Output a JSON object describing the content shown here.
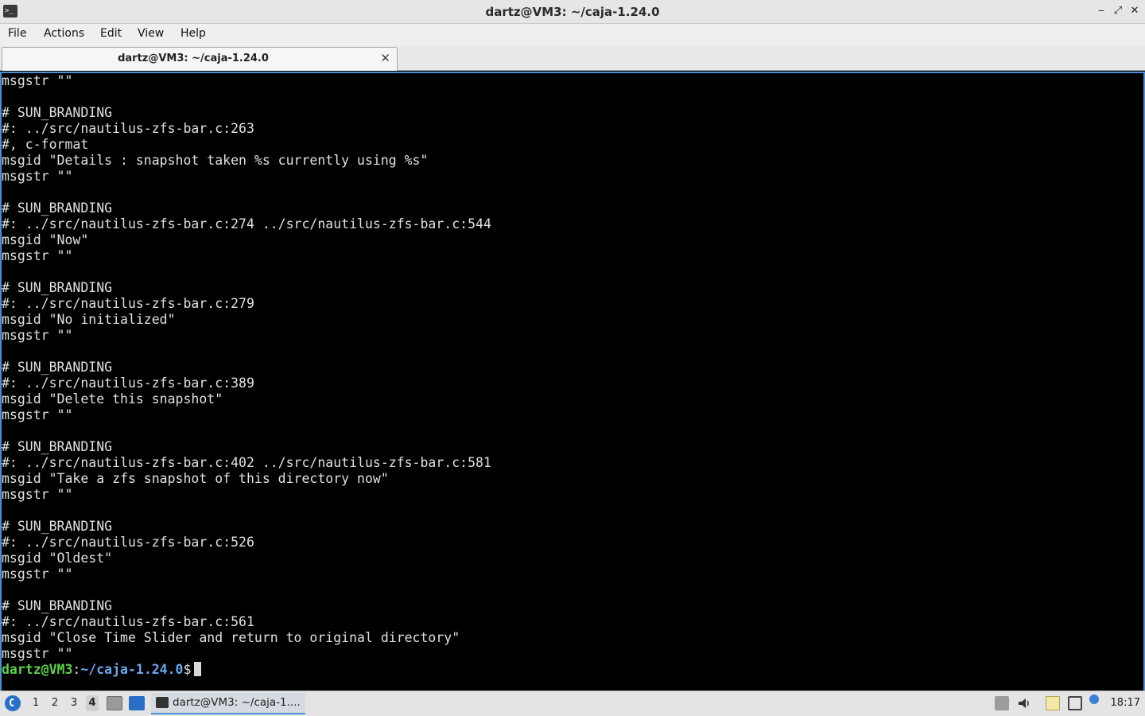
{
  "window": {
    "title": "dartz@VM3: ~/caja-1.24.0",
    "controls": {
      "minimize": "‒",
      "maximize": "⤢",
      "close": "✕"
    }
  },
  "menubar": {
    "items": [
      "File",
      "Actions",
      "Edit",
      "View",
      "Help"
    ]
  },
  "tabs": [
    {
      "label": "dartz@VM3: ~/caja-1.24.0",
      "close": "✕"
    }
  ],
  "terminal": {
    "lines": [
      "msgstr \"\"",
      "",
      "# SUN_BRANDING",
      "#: ../src/nautilus-zfs-bar.c:263",
      "#, c-format",
      "msgid \"Details : snapshot taken %s currently using %s\"",
      "msgstr \"\"",
      "",
      "# SUN_BRANDING",
      "#: ../src/nautilus-zfs-bar.c:274 ../src/nautilus-zfs-bar.c:544",
      "msgid \"Now\"",
      "msgstr \"\"",
      "",
      "# SUN_BRANDING",
      "#: ../src/nautilus-zfs-bar.c:279",
      "msgid \"No initialized\"",
      "msgstr \"\"",
      "",
      "# SUN_BRANDING",
      "#: ../src/nautilus-zfs-bar.c:389",
      "msgid \"Delete this snapshot\"",
      "msgstr \"\"",
      "",
      "# SUN_BRANDING",
      "#: ../src/nautilus-zfs-bar.c:402 ../src/nautilus-zfs-bar.c:581",
      "msgid \"Take a zfs snapshot of this directory now\"",
      "msgstr \"\"",
      "",
      "# SUN_BRANDING",
      "#: ../src/nautilus-zfs-bar.c:526",
      "msgid \"Oldest\"",
      "msgstr \"\"",
      "",
      "# SUN_BRANDING",
      "#: ../src/nautilus-zfs-bar.c:561",
      "msgid \"Close Time Slider and return to original directory\"",
      "msgstr \"\""
    ],
    "prompt": {
      "user_host": "dartz@VM3",
      "colon": ":",
      "path": "~/caja-1.24.0",
      "symbol": "$"
    }
  },
  "taskbar": {
    "workspaces": [
      "1",
      "2",
      "3",
      "4"
    ],
    "active_workspace": "4",
    "task_label": "dartz@VM3: ~/caja-1....",
    "clock": "18:17"
  },
  "colors": {
    "accent": "#4a90d9",
    "prompt_user": "#5ed14a",
    "prompt_path": "#6aa8f0",
    "terminal_bg": "#000000",
    "terminal_fg": "#e0e0e0"
  }
}
